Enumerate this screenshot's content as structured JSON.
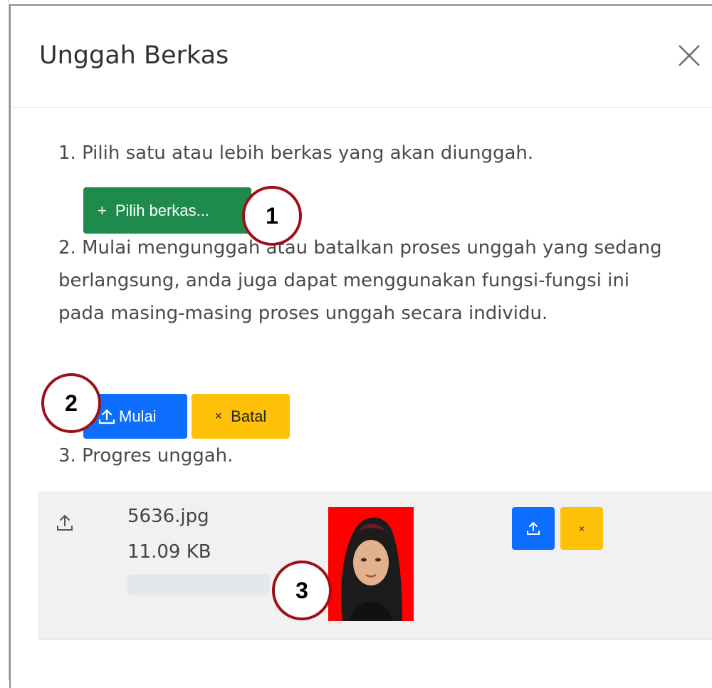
{
  "modal": {
    "title": "Unggah Berkas",
    "close_icon": "close-icon"
  },
  "steps": {
    "step1": "1. Pilih satu atau lebih berkas yang akan diunggah.",
    "step2": "2. Mulai mengunggah atau batalkan proses unggah yang sedang berlangsung, anda juga dapat menggunakan fungsi-fungsi ini pada masing-masing proses unggah secara individu.",
    "step3": "3. Progres unggah."
  },
  "buttons": {
    "choose_icon": "+",
    "choose_label": "Pilih berkas...",
    "start_label": "Mulai",
    "cancel_icon": "×",
    "cancel_label": "Batal"
  },
  "callouts": [
    "1",
    "2",
    "3"
  ],
  "file": {
    "name": "5636.jpg",
    "size": "11.09 KB",
    "progress": 0,
    "cancel_icon": "×"
  },
  "colors": {
    "choose_button": "#1e8a4c",
    "start_button": "#0d6efd",
    "cancel_button": "#ffc107",
    "callout_border": "#9e1016"
  }
}
